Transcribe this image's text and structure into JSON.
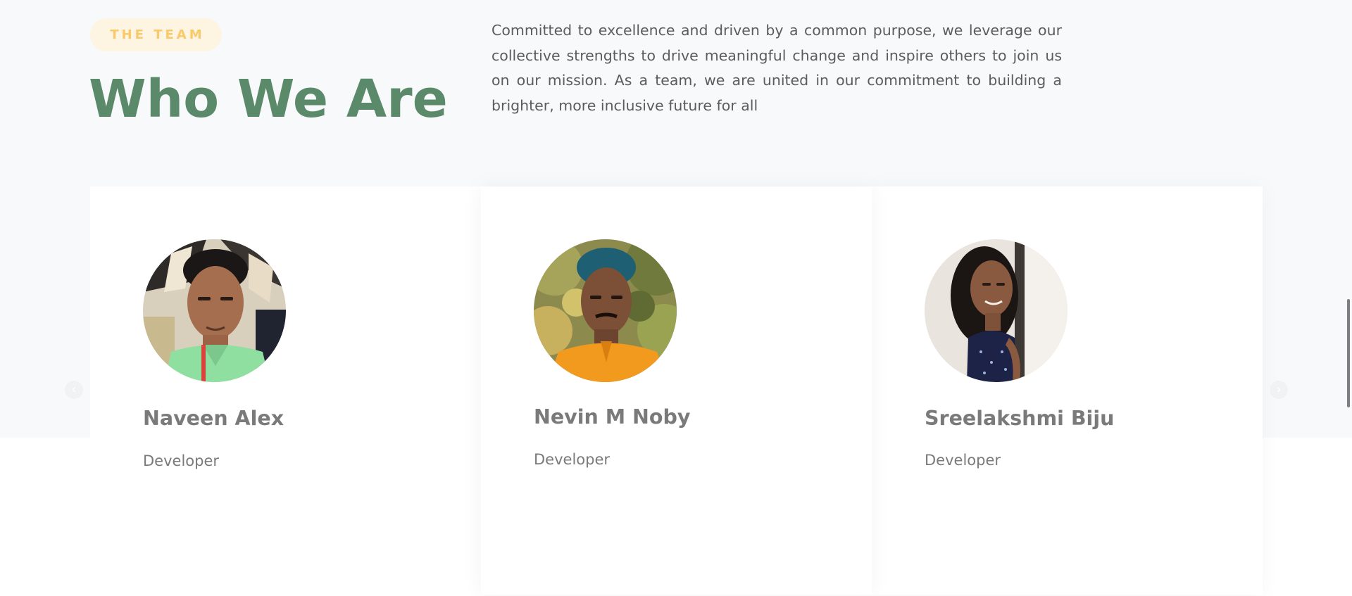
{
  "section": {
    "tag": "THE TEAM",
    "title": "Who We Are",
    "intro": "Committed to excellence and driven by a common purpose, we leverage our collective strengths to drive meaningful change and inspire others to join us on our mission. As a team, we are united in our commitment to building a brighter, more inclusive future for all"
  },
  "team": {
    "members": [
      {
        "name": "Naveen Alex",
        "role": "Developer"
      },
      {
        "name": "Nevin M Noby",
        "role": "Developer"
      },
      {
        "name": "Sreelakshmi Biju",
        "role": "Developer"
      }
    ],
    "prev_icon": "‹",
    "next_icon": "›"
  },
  "colors": {
    "title_green": "#5a8a6a",
    "tag_text": "#f9c96a",
    "tag_bg": "#fdf4e1",
    "band_bg": "#f8f9fb",
    "text_gray": "#7a7a7a"
  },
  "icons": {
    "prev": "chevron-left-icon",
    "next": "chevron-right-icon"
  }
}
